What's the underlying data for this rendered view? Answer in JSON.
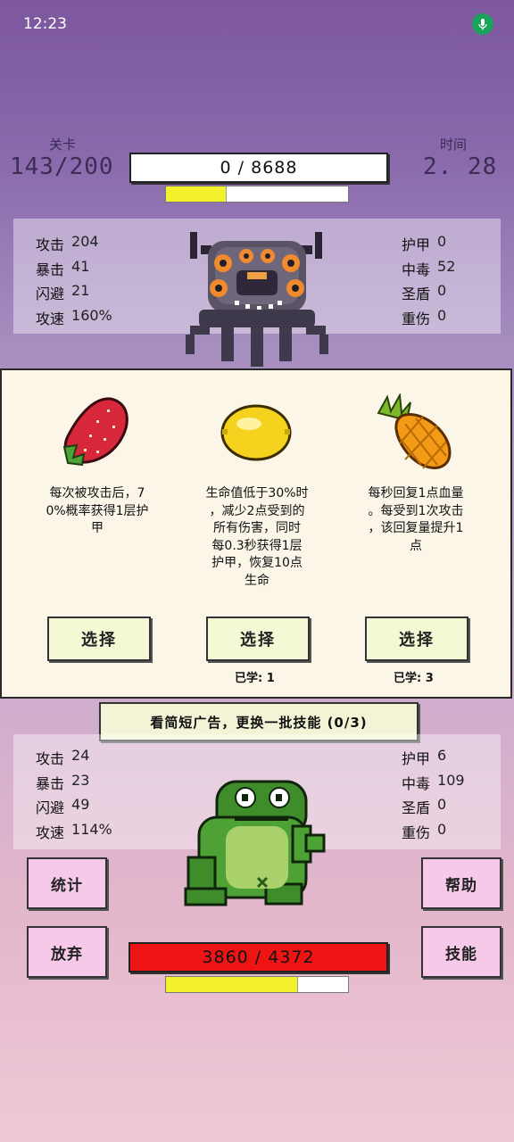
{
  "status_bar": {
    "time": "12:23"
  },
  "enemy": {
    "level_label": "关卡",
    "level_value": "143/200",
    "time_label": "时间",
    "time_value": "2. 28",
    "hp_text": "0 / 8688",
    "energy_fraction": 0.33,
    "stats_left": [
      {
        "label": "攻击",
        "value": "204"
      },
      {
        "label": "暴击",
        "value": "41"
      },
      {
        "label": "闪避",
        "value": "21"
      },
      {
        "label": "攻速",
        "value": "160%"
      }
    ],
    "stats_right": [
      {
        "label": "护甲",
        "value": "0"
      },
      {
        "label": "中毒",
        "value": "52"
      },
      {
        "label": "圣盾",
        "value": "0"
      },
      {
        "label": "重伤",
        "value": "0"
      }
    ],
    "sprite": "purple-tentacle-monster"
  },
  "skill_choices": [
    {
      "icon": "strawberry-icon",
      "desc_lines": [
        "每次被攻击后，7",
        "0%概率获得1层护",
        "甲"
      ],
      "button": "选择",
      "learned": ""
    },
    {
      "icon": "lemon-icon",
      "desc_lines": [
        "生命值低于30%时",
        "，减少2点受到的",
        "所有伤害，同时",
        "每0.3秒获得1层",
        "护甲，恢复10点",
        "生命"
      ],
      "button": "选择",
      "learned": "已学: 1"
    },
    {
      "icon": "pineapple-icon",
      "desc_lines": [
        "每秒回复1点血量",
        "。每受到1次攻击",
        "，该回复量提升1",
        "点"
      ],
      "button": "选择",
      "learned": "已学: 3"
    }
  ],
  "ad_button": "看简短广告，更换一批技能 (0/3)",
  "player": {
    "stats_left": [
      {
        "label": "攻击",
        "value": "24"
      },
      {
        "label": "暴击",
        "value": "23"
      },
      {
        "label": "闪避",
        "value": "49"
      },
      {
        "label": "攻速",
        "value": "114%"
      }
    ],
    "stats_right": [
      {
        "label": "护甲",
        "value": "6"
      },
      {
        "label": "中毒",
        "value": "109"
      },
      {
        "label": "圣盾",
        "value": "0"
      },
      {
        "label": "重伤",
        "value": "0"
      }
    ],
    "hp_text": "3860 / 4372",
    "energy_fraction": 0.72,
    "sprite": "green-frog"
  },
  "buttons": {
    "stats": "统计",
    "giveup": "放弃",
    "help": "帮助",
    "skills": "技能"
  },
  "colors": {
    "enemy_hp": "#ffffff",
    "player_hp": "#ee1414",
    "energy": "#f3f12b",
    "pink_button": "#f7c9e9",
    "card_bg": "#fbf6e8"
  }
}
